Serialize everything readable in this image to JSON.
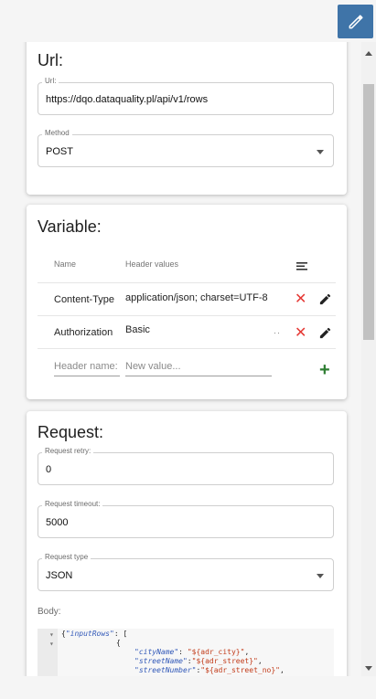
{
  "url_card": {
    "title": "Url:",
    "url_field": {
      "label": "Url:",
      "value": "https://dqo.dataquality.pl/api/v1/rows"
    },
    "method_field": {
      "label": "Method",
      "value": "POST"
    }
  },
  "variable_card": {
    "title": "Variable:",
    "columns": {
      "name": "Name",
      "values": "Header values"
    },
    "rows": [
      {
        "name": "Content-Type",
        "value": "application/json; charset=UTF-8",
        "more": ""
      },
      {
        "name": "Authorization",
        "value": "Basic",
        "more": "··"
      }
    ],
    "new_row": {
      "name_placeholder": "Header name:",
      "value_placeholder": "New value..."
    }
  },
  "request_card": {
    "title": "Request:",
    "retry_field": {
      "label": "Request retry:",
      "value": "0"
    },
    "timeout_field": {
      "label": "Request timeout:",
      "value": "5000"
    },
    "type_field": {
      "label": "Request type",
      "value": "JSON"
    },
    "body_label": "Body:",
    "code": {
      "line1_key": "\"inputRows\"",
      "line1_rest": ": [",
      "line2": "{",
      "line3_key": "\"cityName\"",
      "line3_val": "\"${adr_city}\"",
      "line4_key": "\"streetName\"",
      "line4_val": "\"${adr_street}\"",
      "line5_key": "\"streetNumber\"",
      "line5_val": "\"${adr_street_no}\""
    }
  },
  "icons": [
    "pencil-icon",
    "delete-icon",
    "add-icon",
    "sort-icon",
    "dropdown-caret-icon"
  ],
  "colors": {
    "accent": "#3f74a8",
    "delete": "#e53935",
    "add": "#2e7d32"
  }
}
